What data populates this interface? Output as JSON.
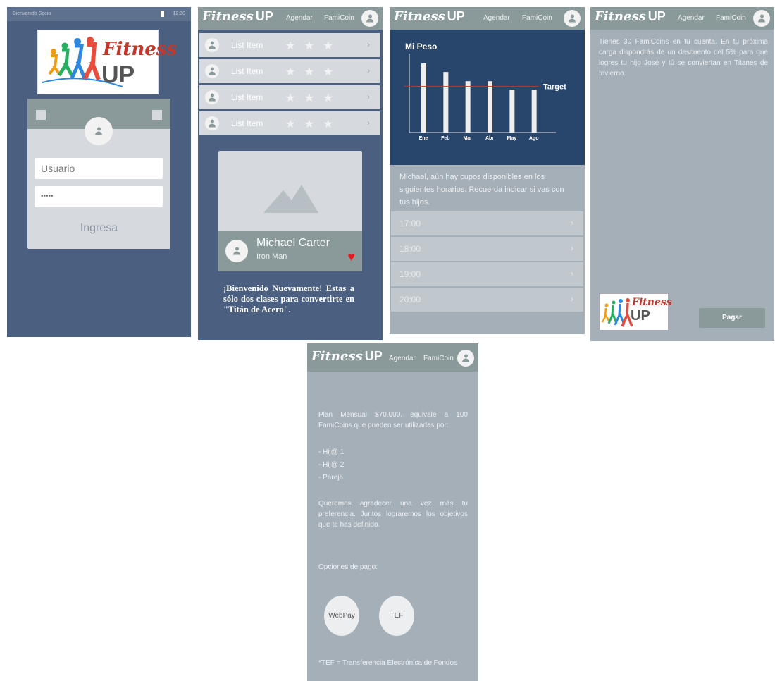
{
  "header": {
    "logo_fit": "Fitness",
    "logo_up": "UP",
    "agendar": "Agendar",
    "famicoin": "FamiCoin"
  },
  "screen1": {
    "status_left": "Bienvenido Socio",
    "status_time": "12:30",
    "logo_fit": "Fitness",
    "logo_up": "UP",
    "username_placeholder": "Usuario",
    "password_value": "•••••",
    "login_label": "Ingresa"
  },
  "screen2": {
    "list_items": [
      {
        "label": "List Item",
        "stars": "★ ★ ★",
        "chevron": "›"
      },
      {
        "label": "List Item",
        "stars": "★ ★ ★",
        "chevron": "›"
      },
      {
        "label": "List Item",
        "stars": "★ ★ ★",
        "chevron": "›"
      },
      {
        "label": "List Item",
        "stars": "★ ★ ★",
        "chevron": "›"
      }
    ],
    "profile_name": "Michael Carter",
    "profile_subtitle": "Iron Man",
    "welcome_text": "¡Bienvenido Nuevamente! Estas a sólo dos clases para convertirte en \"Titán de Acero\"."
  },
  "screen3": {
    "chart_title": "Mi Peso",
    "message": "Michael, aún hay cupos disponibles en los siguientes horarios. Recuerda indicar si vas con tus hijos.",
    "slots": [
      "17:00",
      "18:00",
      "19:00",
      "20:00"
    ]
  },
  "chart_data": {
    "type": "bar",
    "title": "Mi Peso",
    "categories": [
      "Ene",
      "Feb",
      "Mar",
      "Abr",
      "May",
      "Ago"
    ],
    "values": [
      10.5,
      9.2,
      7.8,
      7.8,
      6.5,
      6.5
    ],
    "target": 7,
    "target_label": "Target",
    "ylim": [
      0,
      12
    ],
    "colors": {
      "bar": "#eeeeee",
      "target": "#c0392b",
      "background": "#28466c"
    }
  },
  "screen4": {
    "message": "Tienes 30 FamiCoins en tu cuenta. En tu próxima carga dispondrás de un descuento del 5% para que logres tu hijo José y tú se conviertan en Titanes de Invierno.",
    "logo_fit": "Fitness",
    "logo_up": "UP",
    "pay_label": "Pagar"
  },
  "screen5": {
    "plan_text": "Plan Mensual $70.000, equivale a 100 FamiCoins que pueden ser utilizadas por:",
    "beneficiaries": [
      "- Hij@ 1",
      "- Hij@ 2",
      "- Pareja"
    ],
    "thanks_text": "Queremos agradecer una vez más tu preferencia. Juntos lograremos los objetivos que te has definido.",
    "payment_options_label": "Opciones de pago:",
    "option_webpay": "WebPay",
    "option_tef": "TEF",
    "footnote": "*TEF = Transferencia Electrónica de Fondos"
  },
  "colors": {
    "dark_blue": "#4b6080",
    "header_gray": "#8a9a9a",
    "panel_gray": "#a4afb8",
    "heart": "#e81919"
  }
}
